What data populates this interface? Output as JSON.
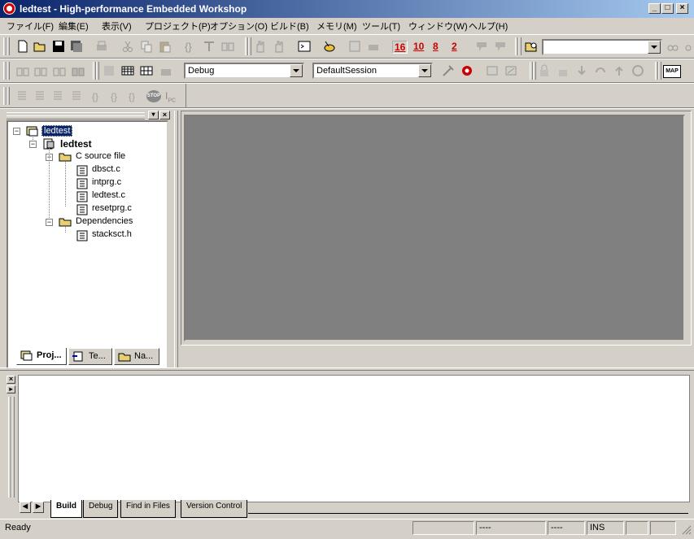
{
  "window": {
    "title": "ledtest - High-performance Embedded Workshop",
    "buttons": {
      "minimize": "_",
      "maximize": "□",
      "close": "×"
    }
  },
  "menubar": [
    {
      "label": "ファイル(F)"
    },
    {
      "label": "編集(E)"
    },
    {
      "label": "表示(V)"
    },
    {
      "label": "プロジェクト(P)"
    },
    {
      "label": "オプション(O)"
    },
    {
      "label": "ビルド(B)"
    },
    {
      "label": "メモリ(M)"
    },
    {
      "label": "ツール(T)"
    },
    {
      "label": "ウィンドウ(W)"
    },
    {
      "label": "ヘルプ(H)"
    }
  ],
  "toolbar": {
    "radix_buttons": [
      "16",
      "10",
      "8",
      "2"
    ],
    "find_combo_value": "",
    "build_config": "Debug",
    "session": "DefaultSession",
    "map_label": "MAP",
    "stop_label": "STOP",
    "pc_label": "PC"
  },
  "project_tree": {
    "workspace": "ledtest",
    "project": "ledtest",
    "folders": [
      {
        "name": "C source file",
        "files": [
          "dbsct.c",
          "intprg.c",
          "ledtest.c",
          "resetprg.c"
        ]
      },
      {
        "name": "Dependencies",
        "files": [
          "stacksct.h"
        ]
      }
    ]
  },
  "panel_tabs": [
    {
      "label": "Proj..."
    },
    {
      "label": "Te..."
    },
    {
      "label": "Na..."
    }
  ],
  "output_tabs": [
    {
      "label": "Build"
    },
    {
      "label": "Debug"
    },
    {
      "label": "Find in Files"
    },
    {
      "label": "Version Control"
    }
  ],
  "statusbar": {
    "ready": "Ready",
    "pane2": "----",
    "pane3": "----",
    "ins": "INS"
  }
}
